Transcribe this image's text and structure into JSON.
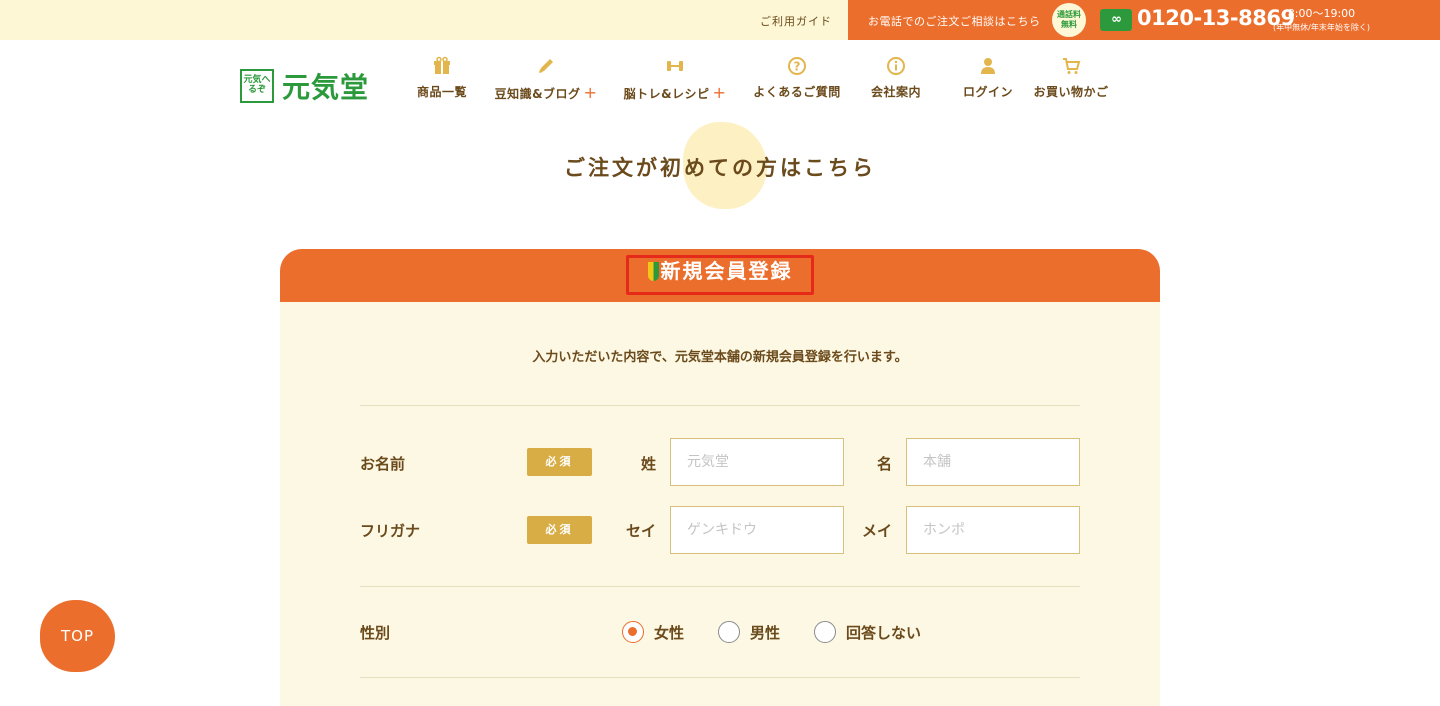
{
  "topbar": {
    "guide_label": "ご利用ガイド",
    "tel_message": "お電話でのご注文ご相談はこちら",
    "free_badge": [
      "通話料",
      "無料"
    ],
    "free_dial_icon": "freedial-icon",
    "tel_number": "0120-13-8869",
    "hours": "8:00〜19:00",
    "hours_note": "(年中無休/年末年始を除く)"
  },
  "header": {
    "logo_mark": "元気へるぞ",
    "logo_text": "元気堂",
    "nav": [
      {
        "label": "商品一覧",
        "icon": "gift-icon",
        "plus": ""
      },
      {
        "label": "豆知識&ブログ",
        "icon": "pencil-icon",
        "plus": "+"
      },
      {
        "label": "脳トレ&レシピ",
        "icon": "dumbbell-icon",
        "plus": "+"
      },
      {
        "label": "よくあるご質問",
        "icon": "question-icon",
        "plus": ""
      },
      {
        "label": "会社案内",
        "icon": "info-icon",
        "plus": ""
      },
      {
        "label": "ログイン",
        "icon": "user-icon",
        "plus": ""
      },
      {
        "label": "お買い物かご",
        "icon": "cart-icon",
        "plus": ""
      }
    ]
  },
  "page_title": "ご注文が初めての方はこちら",
  "form": {
    "heading": "新規会員登録",
    "intro": "入力いただいた内容で、元気堂本舗の新規会員登録を行います。",
    "required_label": "必須",
    "name": {
      "label": "お名前",
      "last_label": "姓",
      "last_placeholder": "元気堂",
      "first_label": "名",
      "first_placeholder": "本舗"
    },
    "furigana": {
      "label": "フリガナ",
      "last_label": "セイ",
      "last_placeholder": "ゲンキドウ",
      "first_label": "メイ",
      "first_placeholder": "ホンポ"
    },
    "gender": {
      "label": "性別",
      "options": [
        "女性",
        "男性",
        "回答しない"
      ],
      "selected": "女性"
    }
  },
  "top_button": "TOP",
  "colors": {
    "accent": "#ec6e2c",
    "brand_green": "#2c9a3c",
    "highlight_border": "#e62a1a"
  }
}
